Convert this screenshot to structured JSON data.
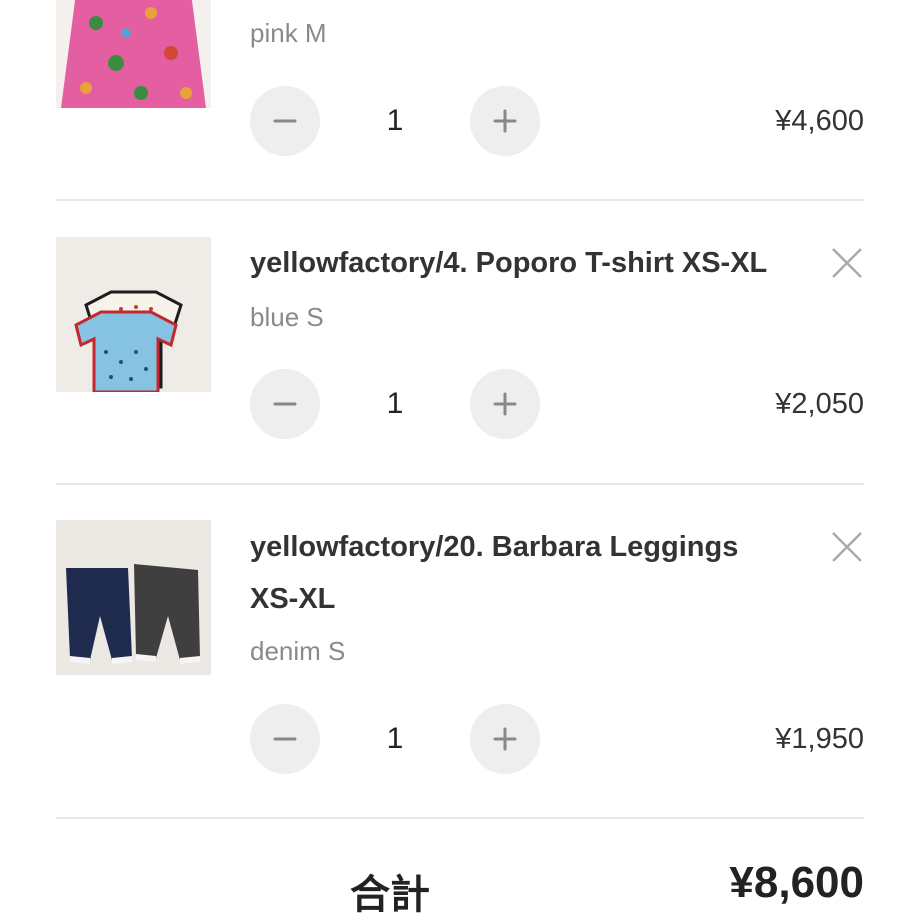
{
  "cart": {
    "items": [
      {
        "name": "",
        "variant": "pink M",
        "quantity": "1",
        "price": "¥4,600",
        "decrement_icon": "minus-icon",
        "increment_icon": "plus-icon"
      },
      {
        "name": "yellowfactory/4. Poporo T-shirt XS-XL",
        "variant": "blue S",
        "quantity": "1",
        "price": "¥2,050",
        "remove_icon": "close-icon",
        "decrement_icon": "minus-icon",
        "increment_icon": "plus-icon"
      },
      {
        "name_line1": "yellowfactory/20. Barbara Leggings",
        "name_line2": "XS-XL",
        "variant": "denim S",
        "quantity": "1",
        "price": "¥1,950",
        "remove_icon": "close-icon",
        "decrement_icon": "minus-icon",
        "increment_icon": "plus-icon"
      }
    ],
    "total_label": "合計",
    "total_value": "¥8,600"
  },
  "colors": {
    "text": "#333333",
    "muted": "#8a8a8a",
    "stepper_bg": "#eeeeee",
    "divider": "#e8e8e8"
  }
}
